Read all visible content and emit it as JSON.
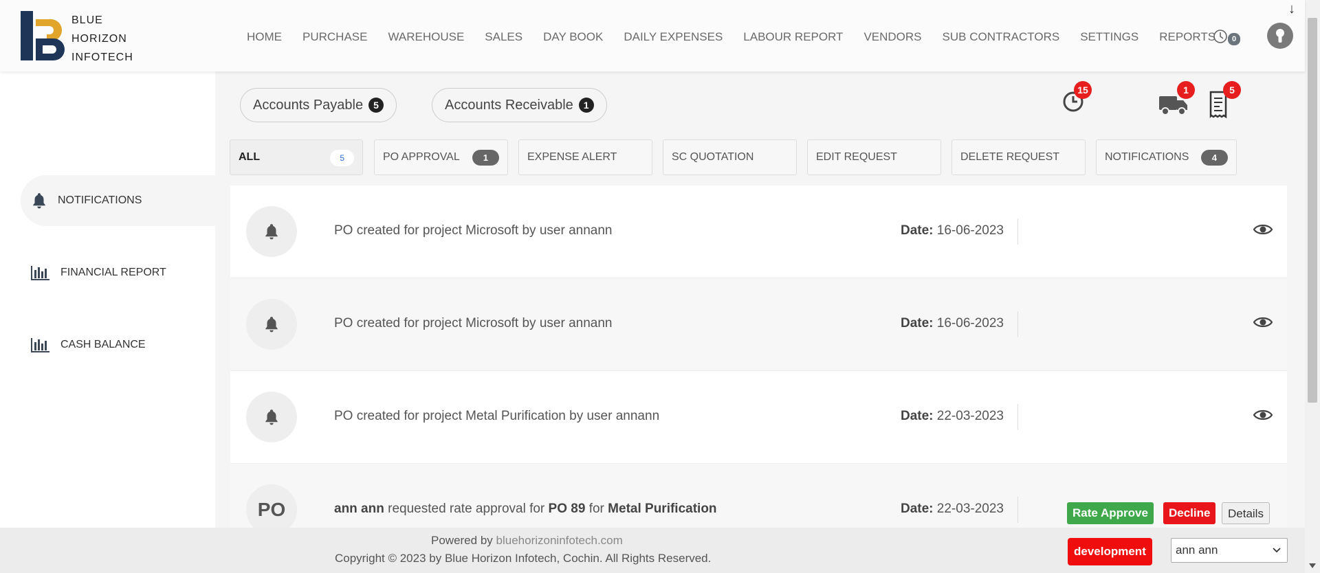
{
  "brand": {
    "line1": "BLUE",
    "line2": "HORIZON",
    "line3": "INFOTECH"
  },
  "nav": [
    "HOME",
    "PURCHASE",
    "WAREHOUSE",
    "SALES",
    "DAY BOOK",
    "DAILY EXPENSES",
    "LABOUR REPORT",
    "VENDORS",
    "SUB CONTRACTORS",
    "SETTINGS",
    "REPORTS"
  ],
  "header": {
    "clock_count": "0",
    "scroll_arrow": "↓"
  },
  "sidebar": {
    "items": [
      {
        "label": "NOTIFICATIONS",
        "icon": "bell-icon"
      },
      {
        "label": "FINANCIAL REPORT",
        "icon": "bar-chart-icon"
      },
      {
        "label": "CASH BALANCE",
        "icon": "bar-chart-icon"
      }
    ]
  },
  "accounts": {
    "payable_label": "Accounts Payable",
    "payable_count": "5",
    "receivable_label": "Accounts Receivable",
    "receivable_count": "1"
  },
  "top_icons": {
    "timer_count": "15",
    "truck_count": "1",
    "receipt_count": "5"
  },
  "tabs": [
    {
      "label": "ALL",
      "count": "5"
    },
    {
      "label": "PO APPROVAL",
      "count": "1"
    },
    {
      "label": "EXPENSE ALERT",
      "count": ""
    },
    {
      "label": "SC QUOTATION",
      "count": ""
    },
    {
      "label": "EDIT REQUEST",
      "count": ""
    },
    {
      "label": "DELETE REQUEST",
      "count": ""
    },
    {
      "label": "NOTIFICATIONS",
      "count": "4"
    }
  ],
  "notifications": [
    {
      "message": "PO created for project Microsoft by user annann",
      "date_label": "Date:",
      "date": "16-06-2023"
    },
    {
      "message": "PO created for project Microsoft by user annann",
      "date_label": "Date:",
      "date": "16-06-2023"
    },
    {
      "message": "PO created for project Metal Purification by user annann",
      "date_label": "Date:",
      "date": "22-03-2023"
    }
  ],
  "rate_request": {
    "avatar_text": "PO",
    "user": "ann ann",
    "text1": "requested rate approval for",
    "po": "PO 89",
    "text2": "for",
    "project": "Metal Purification",
    "date_label": "Date:",
    "date": "22-03-2023",
    "approve_label": "Rate Approve",
    "decline_label": "Decline",
    "details_label": "Details"
  },
  "footer": {
    "powered_prefix": "Powered by",
    "powered_link": "bluehorizoninfotech.com",
    "copyright": "Copyright © 2023 by Blue Horizon Infotech, Cochin. All Rights Reserved.",
    "env_label": "development",
    "user_selected": "ann ann"
  },
  "colors": {
    "accent_red": "#e61e1e",
    "approve_green": "#3ea84a",
    "logo_navy": "#1e3558",
    "logo_gold": "#e0a52a"
  }
}
